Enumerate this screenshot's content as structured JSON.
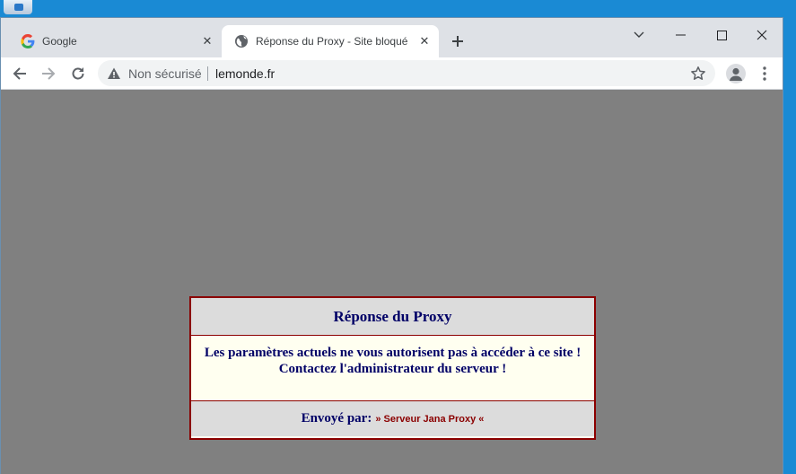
{
  "browser": {
    "tabs": [
      {
        "title": "Google",
        "favicon": "google-icon",
        "active": false
      },
      {
        "title": "Réponse du Proxy - Site bloqué",
        "favicon": "globe-icon",
        "active": true
      }
    ],
    "address_bar": {
      "security_label": "Non sécurisé",
      "url": "lemonde.fr"
    }
  },
  "page": {
    "heading": "Réponse du Proxy",
    "message_line1": "Les paramètres actuels ne vous autorisent pas à accéder à ce site !",
    "message_line2": "Contactez l'administrateur du serveur !",
    "footer_label": "Envoyé par:",
    "footer_server": "» Serveur Jana Proxy «"
  },
  "colors": {
    "page_background": "#808080",
    "box_border": "#8b0000",
    "text_navy": "#000066"
  }
}
